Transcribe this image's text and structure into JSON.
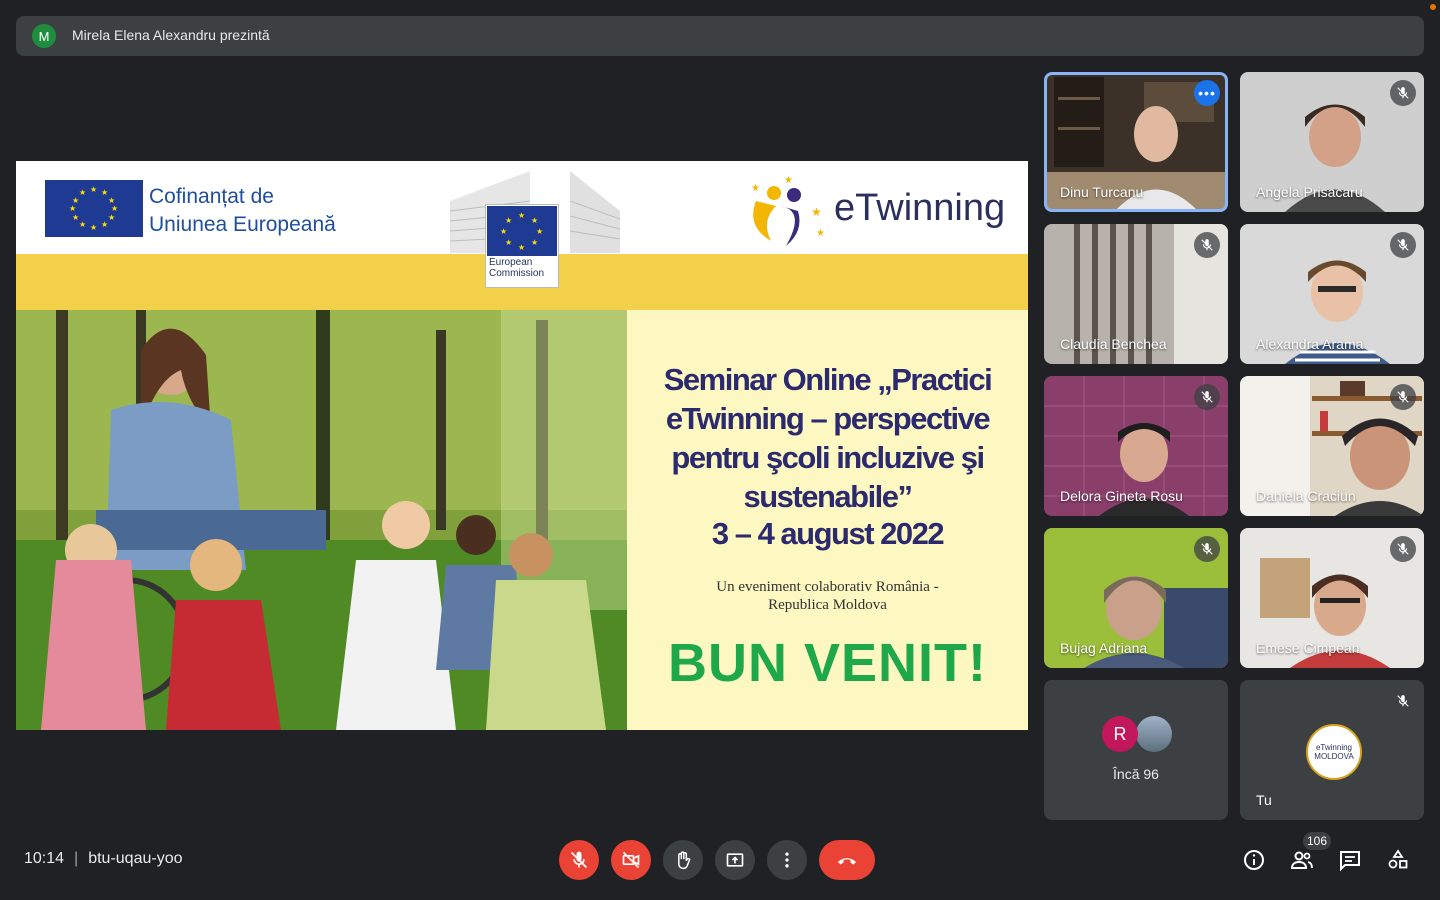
{
  "presenter": {
    "avatar_letter": "M",
    "text": "Mirela Elena Alexandru prezintă"
  },
  "slide": {
    "eu_text_line1": "Cofinanțat de",
    "eu_text_line2": "Uniunea Europeană",
    "ec_text_line1": "European",
    "ec_text_line2": "Commission",
    "etwinning_brand": "eTwinning",
    "title_line1": "Seminar Online „Practici",
    "title_line2": "eTwinning – perspective",
    "title_line3": "pentru şcoli incluzive şi",
    "title_line4": "sustenabile”",
    "date": "3 – 4 august 2022",
    "subtitle_line1": "Un eveniment colaborativ România -",
    "subtitle_line2": "Republica Moldova",
    "welcome": "BUN VENIT!"
  },
  "participants": [
    {
      "name": "Dinu Turcanu",
      "active": true
    },
    {
      "name": "Angela Prisacaru",
      "muted": true
    },
    {
      "name": "Claudia Benchea",
      "muted": true
    },
    {
      "name": "Alexandra Arama",
      "muted": true
    },
    {
      "name": "Delora Gineta Rosu",
      "muted": true
    },
    {
      "name": "Daniela Craciun",
      "muted": true
    },
    {
      "name": "Bujag Adriana",
      "muted": true
    },
    {
      "name": "Emese Cimpean",
      "muted": true
    }
  ],
  "more_tile": {
    "avatar_letter": "R",
    "label": "Încă 96"
  },
  "self_tile": {
    "label": "Tu",
    "logo_text": "eTwinning MOLDOVA"
  },
  "bottom": {
    "time": "10:14",
    "separator": "|",
    "meeting_code": "btu-uqau-yoo",
    "people_count": "106"
  },
  "colors": {
    "background": "#202124",
    "danger": "#ea4335",
    "active_border": "#8ab4f8",
    "welcome_green": "#1ea84a"
  },
  "icons": [
    "mic-off-icon",
    "camera-off-icon",
    "raise-hand-icon",
    "present-icon",
    "more-vert-icon",
    "hang-up-icon",
    "info-icon",
    "people-icon",
    "chat-icon",
    "activities-icon"
  ]
}
